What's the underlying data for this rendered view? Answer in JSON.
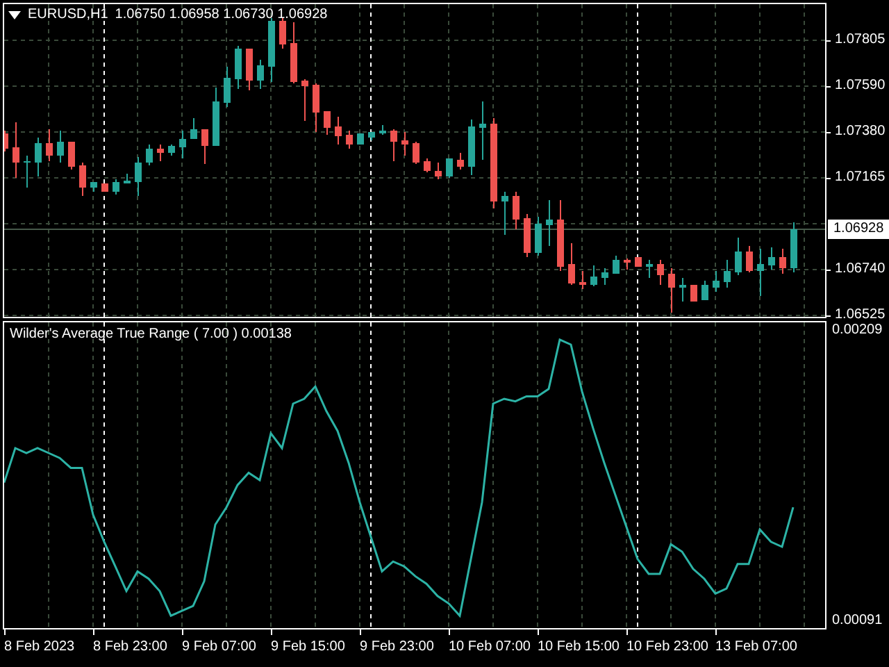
{
  "main_chart": {
    "symbol": "EURUSD,H1",
    "ohlc": [
      "1.06750",
      "1.06958",
      "1.06730",
      "1.06928"
    ],
    "price_labels": [
      "1.07805",
      "1.07590",
      "1.07380",
      "1.07165",
      "1.06740",
      "1.06525"
    ],
    "current_price": "1.06928"
  },
  "indicator": {
    "chart_data": {
      "type": "line",
      "title": "Wilder's Average True Range ( 7.00 ) 0.00138",
      "ylim": [
        0.00089,
        0.00213
      ],
      "grid": true,
      "yticks": [
        {
          "value": 0.00209,
          "label": "0.00209"
        },
        {
          "value": 0.00091,
          "label": "0.00091"
        }
      ],
      "series": [
        {
          "color": "#2cb3a6",
          "values": [
            0.00148,
            0.00162,
            0.0016,
            0.00162,
            0.0016,
            0.00158,
            0.00154,
            0.00154,
            0.00135,
            0.00124,
            0.00114,
            0.00104,
            0.00112,
            0.00109,
            0.00104,
            0.00094,
            0.00096,
            0.00098,
            0.00108,
            0.00131,
            0.00138,
            0.00147,
            0.00152,
            0.00149,
            0.00168,
            0.00162,
            0.0018,
            0.00182,
            0.00187,
            0.00177,
            0.00169,
            0.00156,
            0.0014,
            0.00126,
            0.00112,
            0.00116,
            0.00114,
            0.0011,
            0.00107,
            0.00102,
            0.00099,
            0.00094,
            0.00117,
            0.0014,
            0.0018,
            0.00182,
            0.00181,
            0.00183,
            0.00183,
            0.00186,
            0.00206,
            0.00204,
            0.00185,
            0.0017,
            0.00156,
            0.00143,
            0.0013,
            0.00117,
            0.00111,
            0.00111,
            0.00123,
            0.0012,
            0.00113,
            0.00109,
            0.00103,
            0.00105,
            0.00115,
            0.00115,
            0.00129,
            0.00124,
            0.00122,
            0.00138
          ]
        }
      ]
    }
  },
  "time_axis": [
    "8 Feb 2023",
    "8 Feb 23:00",
    "9 Feb 07:00",
    "9 Feb 15:00",
    "9 Feb 23:00",
    "10 Feb 07:00",
    "10 Feb 15:00",
    "10 Feb 23:00",
    "13 Feb 07:00"
  ]
}
